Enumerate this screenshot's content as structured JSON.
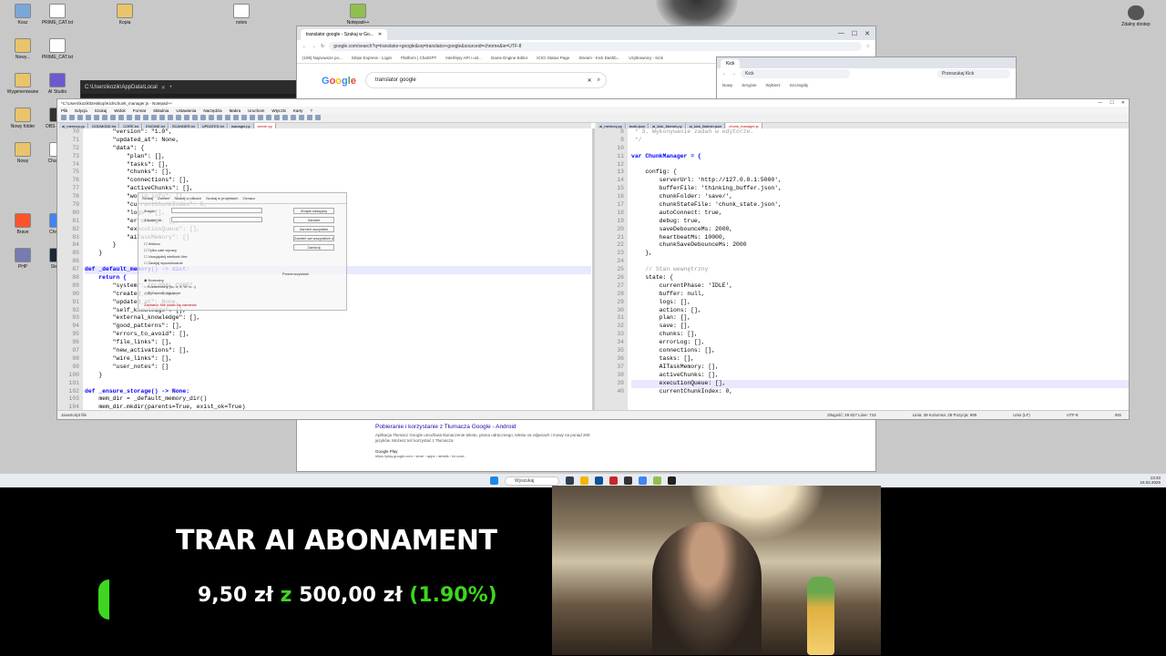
{
  "desktop_icons": [
    {
      "label": "Kosz",
      "color": "#7aa7d9"
    },
    {
      "label": "PRIME_CAT.txt",
      "color": "#ffffff"
    },
    {
      "label": "Nowy...",
      "color": "#e9c46a"
    },
    {
      "label": "PRIME_CAT.txt",
      "color": "#ffffff"
    },
    {
      "label": "Wygenerowane",
      "color": "#e9c46a"
    },
    {
      "label": "AI Studio",
      "color": "#6a5acd"
    },
    {
      "label": "Nowy folder",
      "color": "#e9c46a"
    },
    {
      "label": "OBS Studio",
      "color": "#333333"
    },
    {
      "label": "Nowy",
      "color": "#e9c46a"
    },
    {
      "label": "ChatGPT",
      "color": "#ffffff"
    },
    {
      "label": "Brave",
      "color": "#fb542b"
    },
    {
      "label": "Chrome",
      "color": "#4285f4"
    },
    {
      "label": "PHP",
      "color": "#777bb3"
    },
    {
      "label": "Steam",
      "color": "#1b2838"
    },
    {
      "label": "Kopia",
      "color": "#e9c46a"
    },
    {
      "label": "notes",
      "color": "#ffffff"
    },
    {
      "label": "Notepad++",
      "color": "#90c050"
    }
  ],
  "top_right_icon": {
    "label": "Zdalny dostep"
  },
  "browser": {
    "tab_title": "translator google - Szukaj w Go...",
    "url": "google.com/search?q=translator+google&oq=translator+google&sourceid=chrome&ie=UTF-8",
    "bookmarks": [
      "(199) Najnowsze po...",
      "Stripe Express - Login",
      "Platform | ChatGPT",
      "Interfejsy API i usl...",
      "Game Engine Editor",
      "ICICI Status Page",
      "Stream - Kick Dashb...",
      "Uzytkownicy - Kick"
    ],
    "search_query": "translator google",
    "result_title": "Pobieranie i korzystanie z Tłumacza Google - Android",
    "result_snippet": "Aplikacja Tłumacz Google umożliwia tłumaczenie tekstu, pisma odręcznego, tekstu na zdjęciach i mowy na ponad 200 języków. Możesz też korzystać z Tłumacza",
    "result_source": "Google Play",
    "result_url": "https://play.google.com › store › apps › details › id=com..."
  },
  "browser2": {
    "tab_title": "Kick",
    "search_text": "Przeszukaj Kick",
    "items": [
      "Nowy",
      "Seryjnie",
      "Wybierz",
      "Szczegóły"
    ]
  },
  "terminal": {
    "title": "C:\\Users\\kozik\\AppData\\Local"
  },
  "notepad": {
    "title": "*C:\\Users\\kozik\\Desktop\\Kick\\chunk_manager.js - Notepad++",
    "menu": [
      "Plik",
      "Edycja",
      "Szukaj",
      "Widok",
      "Format",
      "Składnia",
      "Ustawienia",
      "Narzędzia",
      "Makra",
      "Uruchom",
      "Wtyczki",
      "Karty",
      "?"
    ],
    "left_tabs": [
      "ai_memory.py",
      "GODMODE.txt",
      "CORE.txt",
      "ENGINE.txt",
      "SCANNER.txt",
      "UPDATES.txt",
      "manager.py",
      "server.py"
    ],
    "right_tabs": [
      "ai_memory.py",
      "brain.json",
      "ai_kick_listener.py",
      "ai_kick_listener.json",
      "chunk_manager.js"
    ],
    "left_lines": [
      {
        "n": "70",
        "t": "        \"version\": \"1.0\","
      },
      {
        "n": "71",
        "t": "        \"updated_at\": None,"
      },
      {
        "n": "72",
        "t": "        \"data\": {"
      },
      {
        "n": "73",
        "t": "            \"plan\": [],"
      },
      {
        "n": "74",
        "t": "            \"tasks\": [],"
      },
      {
        "n": "75",
        "t": "            \"chunks\": [],"
      },
      {
        "n": "76",
        "t": "            \"connections\": [],"
      },
      {
        "n": "77",
        "t": "            \"activeChunks\": [],"
      },
      {
        "n": "78",
        "t": "            \"world_info\": [],"
      },
      {
        "n": "79",
        "t": "            \"currentChunkIndex\": 0,"
      },
      {
        "n": "80",
        "t": "            \"logs\": [],"
      },
      {
        "n": "81",
        "t": "            \"errorLog\": [],"
      },
      {
        "n": "82",
        "t": "            \"executionQueue\": [],"
      },
      {
        "n": "83",
        "t": "            \"aiTaskMemory\": []"
      },
      {
        "n": "84",
        "t": "        }"
      },
      {
        "n": "85",
        "t": "    }"
      },
      {
        "n": "86",
        "t": ""
      },
      {
        "n": "87",
        "t": "def _default_memory() -> dict:"
      },
      {
        "n": "88",
        "t": "    return {"
      },
      {
        "n": "89",
        "t": "        \"system\": \"GLOBAL_CORE\","
      },
      {
        "n": "90",
        "t": "        \"created_at\": None,"
      },
      {
        "n": "91",
        "t": "        \"updated_at\": None,"
      },
      {
        "n": "92",
        "t": "        \"self_knowledge\": [],"
      },
      {
        "n": "93",
        "t": "        \"external_knowledge\": [],"
      },
      {
        "n": "94",
        "t": "        \"good_patterns\": [],"
      },
      {
        "n": "95",
        "t": "        \"errors_to_avoid\": [],"
      },
      {
        "n": "96",
        "t": "        \"file_links\": [],"
      },
      {
        "n": "97",
        "t": "        \"new_activations\": [],"
      },
      {
        "n": "98",
        "t": "        \"wire_links\": [],"
      },
      {
        "n": "99",
        "t": "        \"user_notes\": []"
      },
      {
        "n": "100",
        "t": "    }"
      },
      {
        "n": "101",
        "t": ""
      },
      {
        "n": "102",
        "t": "def _ensure_storage() -> None:"
      },
      {
        "n": "103",
        "t": "    mem_dir = _default_memory_dir()"
      },
      {
        "n": "104",
        "t": "    mem_dir.mkdir(parents=True, exist_ok=True)"
      },
      {
        "n": "105",
        "t": "    save_dir = _default_save_dir()"
      },
      {
        "n": "106",
        "t": "    save_dir.mkdir(parents=True, exist_ok=True)"
      }
    ],
    "right_lines": [
      {
        "n": "8",
        "t": " * 3. Wykonywanie zadań w edytorze."
      },
      {
        "n": "9",
        "t": " */"
      },
      {
        "n": "10",
        "t": ""
      },
      {
        "n": "11",
        "t": "var ChunkManager = {"
      },
      {
        "n": "12",
        "t": ""
      },
      {
        "n": "13",
        "t": "    config: {"
      },
      {
        "n": "14",
        "t": "        serverUrl: 'http://127.0.0.1:5000',"
      },
      {
        "n": "15",
        "t": "        bufferFile: 'thinking_buffer.json',"
      },
      {
        "n": "16",
        "t": "        chunkFolder: 'save/',"
      },
      {
        "n": "17",
        "t": "        chunkStateFile: 'chunk_state.json',"
      },
      {
        "n": "18",
        "t": "        autoConnect: true,"
      },
      {
        "n": "19",
        "t": "        debug: true,"
      },
      {
        "n": "20",
        "t": "        saveDebounceMs: 2000,"
      },
      {
        "n": "21",
        "t": "        heartbeatMs: 10000,"
      },
      {
        "n": "22",
        "t": "        chunkSaveDebounceMs: 2000"
      },
      {
        "n": "23",
        "t": "    },"
      },
      {
        "n": "24",
        "t": ""
      },
      {
        "n": "25",
        "t": "    // Stan wewnętrzny"
      },
      {
        "n": "26",
        "t": "    state: {"
      },
      {
        "n": "27",
        "t": "        currentPhase: 'IDLE',"
      },
      {
        "n": "28",
        "t": "        buffer: null,"
      },
      {
        "n": "29",
        "t": "        logs: [],"
      },
      {
        "n": "30",
        "t": "        actions: [],"
      },
      {
        "n": "31",
        "t": "        plan: [],"
      },
      {
        "n": "32",
        "t": "        save: [],"
      },
      {
        "n": "33",
        "t": "        chunks: [],"
      },
      {
        "n": "34",
        "t": "        errorLog: [],"
      },
      {
        "n": "35",
        "t": "        connections: [],"
      },
      {
        "n": "36",
        "t": "        tasks: [],"
      },
      {
        "n": "37",
        "t": "        AITaskMemory: [],"
      },
      {
        "n": "38",
        "t": "        activeChunks: [],"
      },
      {
        "n": "39",
        "t": "        executionQueue: [],"
      },
      {
        "n": "40",
        "t": "        currentChunkIndex: 0,"
      }
    ],
    "status_left": "JavaScript file",
    "status_len": "Długość: 29 827    Linie: 743",
    "status_pos": "Linia: 39    Kolumna: 28    Pozycja: 995",
    "status_eol": "Unix (LF)",
    "status_enc": "UTF-8",
    "status_ins": "INS"
  },
  "find_dialog": {
    "tabs": [
      "Szukaj",
      "Zamień",
      "Szukaj w plikach",
      "Szukaj w projektach",
      "Oznacz"
    ],
    "find_label": "Znajdź:",
    "replace_label": "Zamień na:",
    "buttons": [
      "Znajdź następny",
      "Zamień",
      "Zamień wszystkie",
      "Zamień we wszystkich otwartych plikach",
      "Zamknij"
    ],
    "status": "Zamiana: Nie udało się zamienić",
    "opts": [
      "Wstecz",
      "Tylko całe wyrazy",
      "Uwzględnij wielkość liter",
      "Zawijaj wyszukiwanie"
    ],
    "mode_opts": [
      "Normalny",
      "Rozszerzony (\\n, \\r, \\t, \\0, \\x...)",
      "Wyrażenie regularne"
    ],
    "transparency": "Przezroczystość"
  },
  "taskbar": {
    "search": "Wyszukaj",
    "time": "13:33",
    "date": "16.02.2026"
  },
  "overlay": {
    "title": "TRAR AI ABONAMENT",
    "amount": "9,50 zł",
    "conj": "z",
    "goal": "500,00 zł",
    "percent": "(1.90%)",
    "progress": 0.019
  }
}
